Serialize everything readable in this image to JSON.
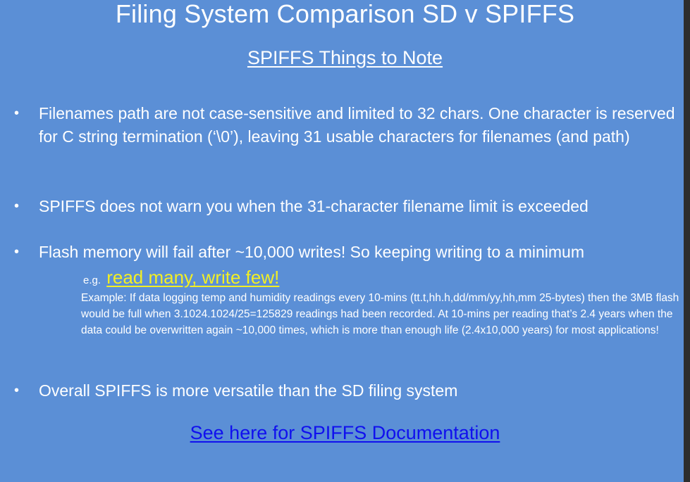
{
  "title": "Filing System Comparison SD v SPIFFS",
  "subtitle": "SPIFFS Things to Note",
  "bullets": [
    {
      "symbol": "•",
      "text": "Filenames path are not case-sensitive and limited to 32 chars. One  character is reserved for C string termination (‘\\0’), leaving 31 usable characters for filenames (and path)"
    },
    {
      "symbol": "•",
      "text": "SPIFFS does not warn you when the 31-character filename limit is exceeded"
    },
    {
      "symbol": "•",
      "text": "Flash memory will fail after ~10,000 writes! So keeping writing to a minimum"
    },
    {
      "symbol": "•",
      "text": "Overall SPIFFS is more versatile than the SD filing system"
    }
  ],
  "eg": {
    "prefix": "e.g.",
    "highlight": "read many, write few!",
    "highlight_color": "#f3ef23"
  },
  "example_text": "Example: If data logging temp and humidity readings every 10-mins  (tt.t,hh.h,dd/mm/yy,hh,mm 25-bytes) then the 3MB flash would be full when 3.1024.1024/25=125829 readings  had been recorded. At 10-mins per reading that’s 2.4 years when the data could be overwritten again ~10,000 times, which is more than enough life (2.4x10,000 years)  for most applications!",
  "link": {
    "text": "See here for SPIFFS Documentation",
    "color": "#1010ee"
  },
  "colors": {
    "background": "#5b8fd6",
    "text": "#ffffff"
  }
}
